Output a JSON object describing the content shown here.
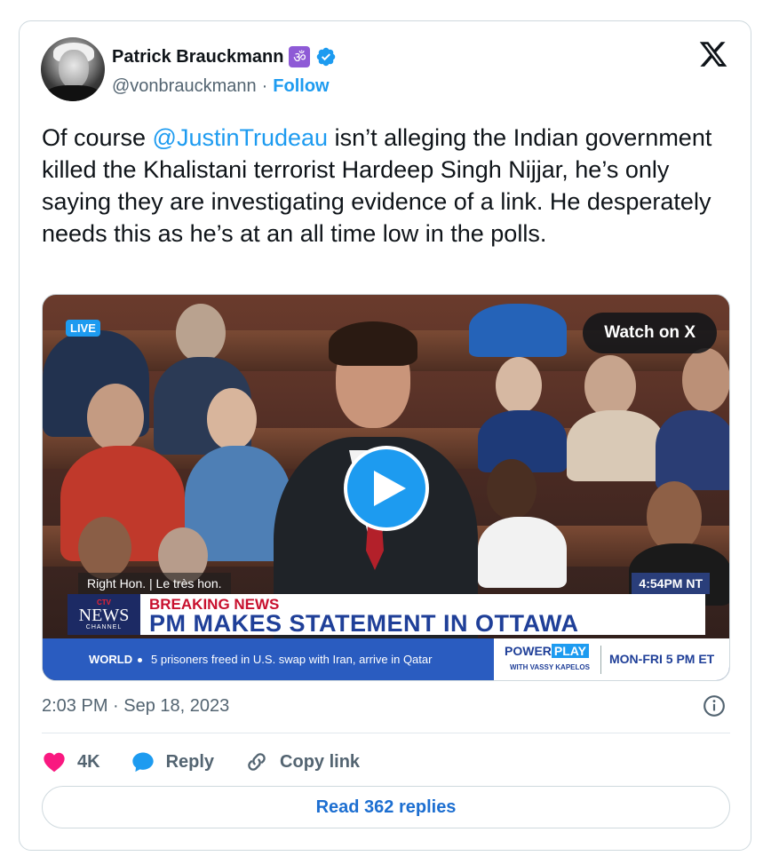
{
  "author": {
    "display_name": "Patrick Brauckmann",
    "handle": "@vonbrauckmann",
    "separator": "·",
    "follow_label": "Follow",
    "badge_glyph": "ॐ"
  },
  "tweet": {
    "text_before": "Of course ",
    "mention": "@JustinTrudeau",
    "text_after": " isn’t alleging the Indian government killed the Khalistani terrorist Hardeep Singh Nijjar, he’s only saying they are investigating evidence of a link. He desperately needs this as he’s at an all time low in the polls.",
    "timestamp": "2:03 PM · Sep 18, 2023"
  },
  "media": {
    "live_label": "LIVE",
    "watch_label": "Watch on X",
    "broadcast": {
      "name_strip": "Right Hon.  |  Le très hon.",
      "time": "4:54PM NT",
      "logo_ctv": "CTV",
      "logo_news": "NEWS",
      "logo_channel": "CHANNEL",
      "breaking_label": "BREAKING NEWS",
      "headline": "PM MAKES STATEMENT IN OTTAWA",
      "ticker_category": "WORLD",
      "ticker_text": "5 prisoners freed in U.S. swap with Iran, arrive in Qatar",
      "promo_power": "POWER",
      "promo_play": "PLAY",
      "promo_host": "WITH VASSY KAPELOS",
      "promo_schedule": "MON-FRI 5 PM ET"
    }
  },
  "actions": {
    "likes": "4K",
    "reply_label": "Reply",
    "copy_label": "Copy link",
    "read_replies": "Read 362 replies"
  },
  "colors": {
    "accent": "#1d9bf0",
    "like": "#f91880",
    "text": "#0f1419",
    "secondary": "#536471",
    "border": "#cfd9de"
  },
  "icons": [
    "x-logo-icon",
    "verified-icon",
    "om-badge-icon",
    "play-icon",
    "info-icon",
    "heart-icon",
    "reply-icon",
    "link-icon"
  ]
}
